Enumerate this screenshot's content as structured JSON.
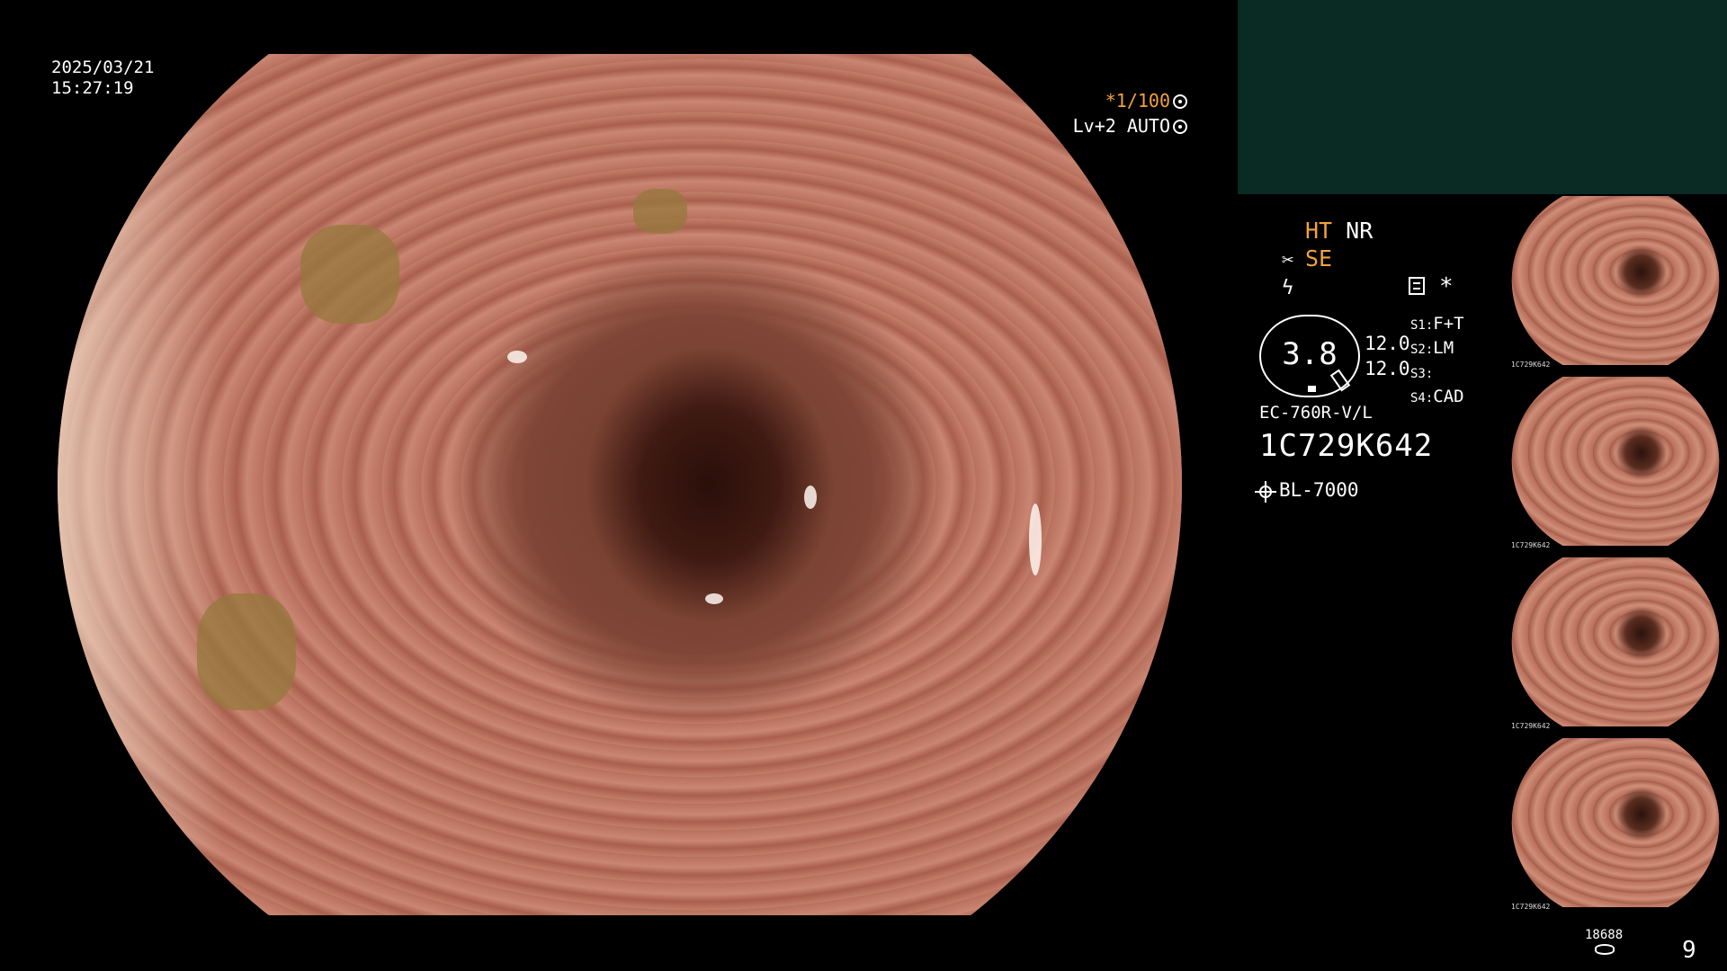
{
  "datetime": {
    "date": "2025/03/21",
    "time": "15:27:19"
  },
  "status": {
    "shutter": "*1/100",
    "level": "Lv+2 AUTO"
  },
  "modes": {
    "ht": "HT",
    "nr": "NR",
    "se": "SE"
  },
  "gauge": {
    "value": "3.8"
  },
  "readings": {
    "v1": "12.0",
    "v2": "12.0"
  },
  "switches": [
    {
      "key": "S1:",
      "value": "F+T"
    },
    {
      "key": "S2:",
      "value": "LM"
    },
    {
      "key": "S3:",
      "value": ""
    },
    {
      "key": "S4:",
      "value": "CAD"
    }
  ],
  "device": {
    "model": "EC-760R-V/L",
    "serial": "1C729K642",
    "light_source": "BL-7000"
  },
  "thumbnails": [
    {
      "label": "1C729K642"
    },
    {
      "label": "1C729K642"
    },
    {
      "label": "1C729K642"
    },
    {
      "label": "1C729K642"
    }
  ],
  "footer": {
    "counter": "18688",
    "page": "9"
  },
  "icons": [
    "shutter-icon",
    "auto-icon",
    "scissors-icon",
    "lightning-icon",
    "memo-icon",
    "asterisk-icon",
    "sun-icon",
    "disk-icon"
  ]
}
